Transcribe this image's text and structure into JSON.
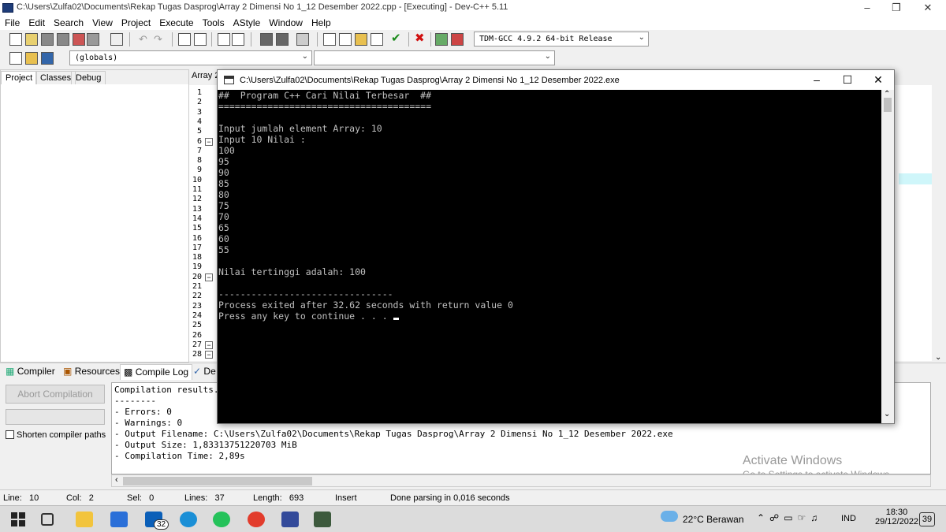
{
  "window": {
    "title": "C:\\Users\\Zulfa02\\Documents\\Rekap Tugas Dasprog\\Array 2 Dimensi No 1_12 Desember 2022.cpp - [Executing] - Dev-C++ 5.11"
  },
  "menu": [
    "File",
    "Edit",
    "Search",
    "View",
    "Project",
    "Execute",
    "Tools",
    "AStyle",
    "Window",
    "Help"
  ],
  "toolbar": {
    "compiler": "TDM-GCC 4.9.2 64-bit Release",
    "scope": "(globals)"
  },
  "left_tabs": [
    "Project",
    "Classes",
    "Debug"
  ],
  "editor": {
    "tab": "Array 2",
    "line_numbers": [
      "1",
      "2",
      "3",
      "4",
      "5",
      "6",
      "7",
      "8",
      "9",
      "10",
      "11",
      "12",
      "13",
      "14",
      "15",
      "16",
      "17",
      "18",
      "19",
      "20",
      "21",
      "22",
      "23",
      "24",
      "25",
      "26",
      "27",
      "28"
    ]
  },
  "console": {
    "title": "C:\\Users\\Zulfa02\\Documents\\Rekap Tugas Dasprog\\Array 2 Dimensi No 1_12 Desember 2022.exe",
    "lines": [
      "##  Program C++ Cari Nilai Terbesar  ##",
      "=======================================",
      "",
      "Input jumlah element Array: 10",
      "Input 10 Nilai :",
      "100",
      "95",
      "90",
      "85",
      "80",
      "75",
      "70",
      "65",
      "60",
      "55",
      "",
      "Nilai tertinggi adalah: 100",
      "",
      "--------------------------------",
      "Process exited after 32.62 seconds with return value 0",
      "Press any key to continue . . . "
    ]
  },
  "bottom_tabs": [
    "Compiler",
    "Resources",
    "Compile Log",
    "De"
  ],
  "compile": {
    "abort_label": "Abort Compilation",
    "shorten_label": "Shorten compiler paths",
    "log": [
      "Compilation results...",
      "--------",
      "- Errors: 0",
      "- Warnings: 0",
      "- Output Filename: C:\\Users\\Zulfa02\\Documents\\Rekap Tugas Dasprog\\Array 2 Dimensi No 1_12 Desember 2022.exe",
      "- Output Size: 1,83313751220703 MiB",
      "- Compilation Time: 2,89s"
    ]
  },
  "watermark": {
    "line1": "Activate Windows",
    "line2": "Go to Settings to activate Windows."
  },
  "status": {
    "line_label": "Line:",
    "line_val": "10",
    "col_label": "Col:",
    "col_val": "2",
    "sel_label": "Sel:",
    "sel_val": "0",
    "lines_label": "Lines:",
    "lines_val": "37",
    "length_label": "Length:",
    "length_val": "693",
    "mode": "Insert",
    "message": "Done parsing in 0,016 seconds"
  },
  "taskbar": {
    "weather": "22°C  Berawan",
    "lang": "IND",
    "time": "18:30",
    "date": "29/12/2022",
    "mail_badge": "32",
    "notif_badge": "39"
  }
}
